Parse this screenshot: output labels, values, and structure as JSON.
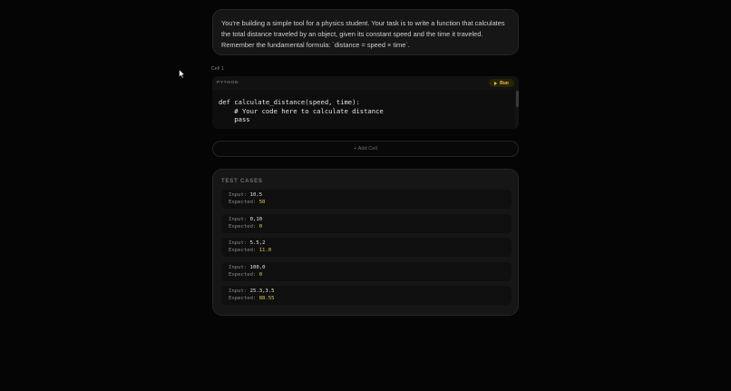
{
  "task": {
    "description": "You're building a simple tool for a physics student. Your task is to write a function that calculates the total distance traveled by an object, given its constant speed and the time it traveled. Remember the fundamental formula: `distance = speed × time`."
  },
  "cell": {
    "label": "Cell 1",
    "language": "PYTHON",
    "run_label": "Run",
    "code_lines": [
      "def calculate_distance(speed, time):",
      "    # Your code here to calculate distance",
      "    pass"
    ]
  },
  "add_cell_label": "+ Add Cell",
  "tests": {
    "title": "TEST CASES",
    "input_label": "Input:",
    "expected_label": "Expected:",
    "cases": [
      {
        "input": "10,5",
        "expected": "50"
      },
      {
        "input": "0,10",
        "expected": "0"
      },
      {
        "input": "5.5,2",
        "expected": "11.0"
      },
      {
        "input": "100,0",
        "expected": "0"
      },
      {
        "input": "25.3,3.5",
        "expected": "88.55"
      }
    ]
  },
  "colors": {
    "accent": "#e9c84b",
    "background": "#050505",
    "card": "#161616"
  },
  "icons": {
    "run": "play-icon",
    "pointer": "mouse-cursor-icon"
  }
}
